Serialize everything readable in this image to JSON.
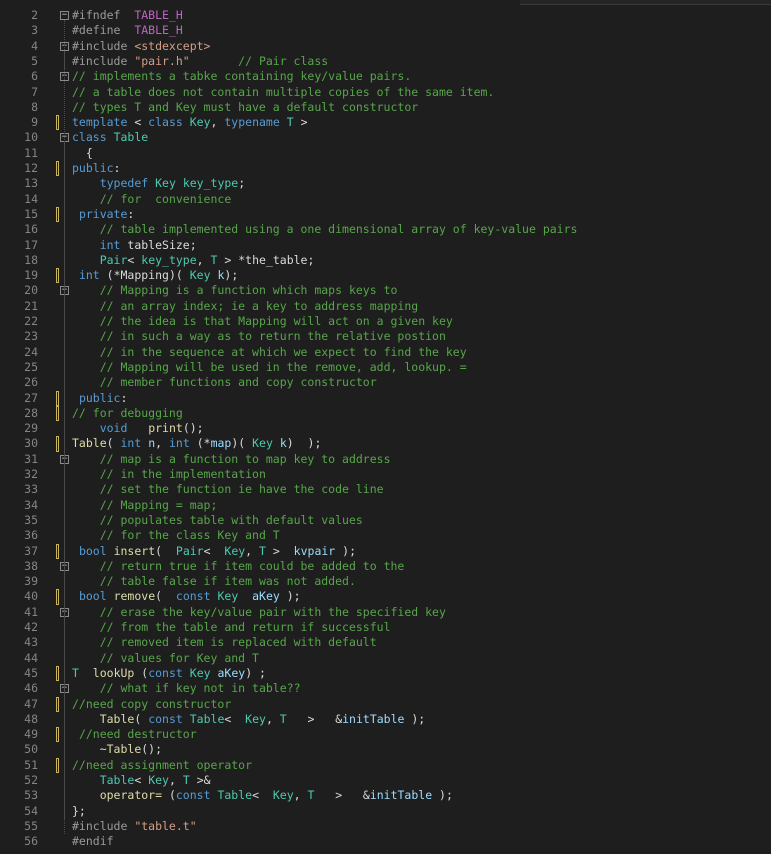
{
  "editor": {
    "language": "C++",
    "colors": {
      "background": "#1e1e1e",
      "line_number": "#858585",
      "keyword": "#569cd6",
      "type": "#4ec9b0",
      "string": "#d69d85",
      "comment": "#57a64a",
      "preprocessor": "#9b9b9b",
      "change_marker": "#c8b45a"
    },
    "lines": [
      {
        "n": "2",
        "fold": "minus",
        "change": false,
        "tokens": [
          [
            "pp",
            "#ifndef "
          ],
          [
            "mac",
            " TABLE_H"
          ]
        ]
      },
      {
        "n": "3",
        "fold": "",
        "change": false,
        "tokens": [
          [
            "pp",
            "#define "
          ],
          [
            "mac",
            " TABLE_H"
          ]
        ]
      },
      {
        "n": "4",
        "fold": "minus",
        "change": false,
        "tokens": [
          [
            "pp",
            "#include "
          ],
          [
            "str",
            "<stdexcept>"
          ]
        ]
      },
      {
        "n": "5",
        "fold": "",
        "change": false,
        "tokens": [
          [
            "pp",
            "#include "
          ],
          [
            "str",
            "\"pair.h\""
          ],
          [
            "id",
            "       "
          ],
          [
            "cm",
            "// Pair class"
          ]
        ]
      },
      {
        "n": "6",
        "fold": "minus",
        "change": false,
        "tokens": [
          [
            "cm",
            "// implements a tabke containing key/value pairs."
          ]
        ]
      },
      {
        "n": "7",
        "fold": "",
        "change": false,
        "tokens": [
          [
            "cm",
            "// a table does not contain multiple copies of the same item."
          ]
        ]
      },
      {
        "n": "8",
        "fold": "",
        "change": false,
        "tokens": [
          [
            "cm",
            "// types T and Key must have a default constructor"
          ]
        ]
      },
      {
        "n": "9",
        "fold": "",
        "change": true,
        "tokens": [
          [
            "kw",
            "template"
          ],
          [
            "id",
            " < "
          ],
          [
            "kw",
            "class"
          ],
          [
            "id",
            " "
          ],
          [
            "ty",
            "Key"
          ],
          [
            "id",
            ", "
          ],
          [
            "kw",
            "typename"
          ],
          [
            "id",
            " "
          ],
          [
            "ty",
            "T"
          ],
          [
            "id",
            " >"
          ]
        ]
      },
      {
        "n": "10",
        "fold": "minus",
        "change": false,
        "tokens": [
          [
            "kw",
            "class"
          ],
          [
            "id",
            " "
          ],
          [
            "ty",
            "Table"
          ]
        ]
      },
      {
        "n": "11",
        "fold": "",
        "change": false,
        "tokens": [
          [
            "id",
            "  {"
          ]
        ]
      },
      {
        "n": "12",
        "fold": "",
        "change": true,
        "tokens": [
          [
            "kw",
            "public"
          ],
          [
            "id",
            ":"
          ]
        ]
      },
      {
        "n": "13",
        "fold": "",
        "change": false,
        "tokens": [
          [
            "id",
            "    "
          ],
          [
            "kw",
            "typedef"
          ],
          [
            "id",
            " "
          ],
          [
            "ty",
            "Key"
          ],
          [
            "id",
            " "
          ],
          [
            "ty",
            "key_type"
          ],
          [
            "id",
            ";"
          ]
        ]
      },
      {
        "n": "14",
        "fold": "",
        "change": false,
        "tokens": [
          [
            "id",
            "    "
          ],
          [
            "cm",
            "// for  convenience"
          ]
        ]
      },
      {
        "n": "15",
        "fold": "",
        "change": true,
        "tokens": [
          [
            "id",
            " "
          ],
          [
            "kw",
            "private"
          ],
          [
            "id",
            ":"
          ]
        ]
      },
      {
        "n": "16",
        "fold": "",
        "change": false,
        "tokens": [
          [
            "id",
            "    "
          ],
          [
            "cm",
            "// table implemented using a one dimensional array of key-value pairs"
          ]
        ]
      },
      {
        "n": "17",
        "fold": "",
        "change": false,
        "tokens": [
          [
            "id",
            "    "
          ],
          [
            "kw",
            "int"
          ],
          [
            "id",
            " tableSize;"
          ]
        ]
      },
      {
        "n": "18",
        "fold": "",
        "change": false,
        "tokens": [
          [
            "id",
            "    "
          ],
          [
            "ty",
            "Pair"
          ],
          [
            "id",
            "< "
          ],
          [
            "ty",
            "key_type"
          ],
          [
            "id",
            ", "
          ],
          [
            "ty",
            "T"
          ],
          [
            "id",
            " > *the_table;"
          ]
        ]
      },
      {
        "n": "19",
        "fold": "",
        "change": true,
        "tokens": [
          [
            "id",
            " "
          ],
          [
            "kw",
            "int"
          ],
          [
            "id",
            " (*Mapping)( "
          ],
          [
            "ty",
            "Key"
          ],
          [
            "id",
            " "
          ],
          [
            "par",
            "k"
          ],
          [
            "id",
            ");"
          ]
        ]
      },
      {
        "n": "20",
        "fold": "minus",
        "change": false,
        "tokens": [
          [
            "id",
            "    "
          ],
          [
            "cm",
            "// Mapping is a function which maps keys to"
          ]
        ]
      },
      {
        "n": "21",
        "fold": "",
        "change": false,
        "tokens": [
          [
            "id",
            "    "
          ],
          [
            "cm",
            "// an array index; ie a key to address mapping"
          ]
        ]
      },
      {
        "n": "22",
        "fold": "",
        "change": false,
        "tokens": [
          [
            "id",
            "    "
          ],
          [
            "cm",
            "// the idea is that Mapping will act on a given key"
          ]
        ]
      },
      {
        "n": "23",
        "fold": "",
        "change": false,
        "tokens": [
          [
            "id",
            "    "
          ],
          [
            "cm",
            "// in such a way as to return the relative postion"
          ]
        ]
      },
      {
        "n": "24",
        "fold": "",
        "change": false,
        "tokens": [
          [
            "id",
            "    "
          ],
          [
            "cm",
            "// in the sequence at which we expect to find the key"
          ]
        ]
      },
      {
        "n": "25",
        "fold": "",
        "change": false,
        "tokens": [
          [
            "id",
            "    "
          ],
          [
            "cm",
            "// Mapping will be used in the remove, add, lookup. ="
          ]
        ]
      },
      {
        "n": "26",
        "fold": "",
        "change": false,
        "tokens": [
          [
            "id",
            "    "
          ],
          [
            "cm",
            "// member functions and copy constructor"
          ]
        ]
      },
      {
        "n": "27",
        "fold": "",
        "change": true,
        "tokens": [
          [
            "id",
            " "
          ],
          [
            "kw",
            "public"
          ],
          [
            "id",
            ":"
          ]
        ]
      },
      {
        "n": "28",
        "fold": "",
        "change": true,
        "tokens": [
          [
            "cm",
            "// for debugging"
          ]
        ]
      },
      {
        "n": "29",
        "fold": "",
        "change": false,
        "tokens": [
          [
            "id",
            "    "
          ],
          [
            "kw",
            "void"
          ],
          [
            "id",
            "   "
          ],
          [
            "fn",
            "print"
          ],
          [
            "id",
            "();"
          ]
        ]
      },
      {
        "n": "30",
        "fold": "",
        "change": true,
        "tokens": [
          [
            "fn",
            "Table"
          ],
          [
            "id",
            "( "
          ],
          [
            "kw",
            "int"
          ],
          [
            "id",
            " "
          ],
          [
            "par",
            "n"
          ],
          [
            "id",
            ", "
          ],
          [
            "kw",
            "int"
          ],
          [
            "id",
            " (*"
          ],
          [
            "par",
            "map"
          ],
          [
            "id",
            ")( "
          ],
          [
            "ty",
            "Key"
          ],
          [
            "id",
            " "
          ],
          [
            "par",
            "k"
          ],
          [
            "id",
            ")  );"
          ]
        ]
      },
      {
        "n": "31",
        "fold": "minus",
        "change": false,
        "tokens": [
          [
            "id",
            "    "
          ],
          [
            "cm",
            "// map is a function to map key to address"
          ]
        ]
      },
      {
        "n": "32",
        "fold": "",
        "change": false,
        "tokens": [
          [
            "id",
            "    "
          ],
          [
            "cm",
            "// in the implementation"
          ]
        ]
      },
      {
        "n": "33",
        "fold": "",
        "change": false,
        "tokens": [
          [
            "id",
            "    "
          ],
          [
            "cm",
            "// set the function ie have the code line"
          ]
        ]
      },
      {
        "n": "34",
        "fold": "",
        "change": false,
        "tokens": [
          [
            "id",
            "    "
          ],
          [
            "cm",
            "// Mapping = map;"
          ]
        ]
      },
      {
        "n": "35",
        "fold": "",
        "change": false,
        "tokens": [
          [
            "id",
            "    "
          ],
          [
            "cm",
            "// populates table with default values"
          ]
        ]
      },
      {
        "n": "36",
        "fold": "",
        "change": false,
        "tokens": [
          [
            "id",
            "    "
          ],
          [
            "cm",
            "// for the class Key and T"
          ]
        ]
      },
      {
        "n": "37",
        "fold": "",
        "change": true,
        "tokens": [
          [
            "id",
            " "
          ],
          [
            "kw",
            "bool"
          ],
          [
            "id",
            " "
          ],
          [
            "fn",
            "insert"
          ],
          [
            "id",
            "(  "
          ],
          [
            "ty",
            "Pair"
          ],
          [
            "id",
            "<  "
          ],
          [
            "ty",
            "Key"
          ],
          [
            "id",
            ", "
          ],
          [
            "ty",
            "T"
          ],
          [
            "id",
            " >  "
          ],
          [
            "par",
            "kvpair"
          ],
          [
            "id",
            " );"
          ]
        ]
      },
      {
        "n": "38",
        "fold": "minus",
        "change": false,
        "tokens": [
          [
            "id",
            "    "
          ],
          [
            "cm",
            "// return true if item could be added to the"
          ]
        ]
      },
      {
        "n": "39",
        "fold": "",
        "change": false,
        "tokens": [
          [
            "id",
            "    "
          ],
          [
            "cm",
            "// table false if item was not added."
          ]
        ]
      },
      {
        "n": "40",
        "fold": "",
        "change": true,
        "tokens": [
          [
            "id",
            " "
          ],
          [
            "kw",
            "bool"
          ],
          [
            "id",
            " "
          ],
          [
            "fn",
            "remove"
          ],
          [
            "id",
            "(  "
          ],
          [
            "kw",
            "const"
          ],
          [
            "id",
            " "
          ],
          [
            "ty",
            "Key"
          ],
          [
            "id",
            "  "
          ],
          [
            "par",
            "aKey"
          ],
          [
            "id",
            " );"
          ]
        ]
      },
      {
        "n": "41",
        "fold": "minus",
        "change": false,
        "tokens": [
          [
            "id",
            "    "
          ],
          [
            "cm",
            "// erase the key/value pair with the specified key"
          ]
        ]
      },
      {
        "n": "42",
        "fold": "",
        "change": false,
        "tokens": [
          [
            "id",
            "    "
          ],
          [
            "cm",
            "// from the table and return if successful"
          ]
        ]
      },
      {
        "n": "43",
        "fold": "",
        "change": false,
        "tokens": [
          [
            "id",
            "    "
          ],
          [
            "cm",
            "// removed item is replaced with default"
          ]
        ]
      },
      {
        "n": "44",
        "fold": "",
        "change": false,
        "tokens": [
          [
            "id",
            "    "
          ],
          [
            "cm",
            "// values for Key and T"
          ]
        ]
      },
      {
        "n": "45",
        "fold": "",
        "change": true,
        "tokens": [
          [
            "ty",
            "T"
          ],
          [
            "id",
            "  "
          ],
          [
            "fn",
            "lookUp"
          ],
          [
            "id",
            " ("
          ],
          [
            "kw",
            "const"
          ],
          [
            "id",
            " "
          ],
          [
            "ty",
            "Key"
          ],
          [
            "id",
            " "
          ],
          [
            "par",
            "aKey"
          ],
          [
            "id",
            ") ;"
          ]
        ]
      },
      {
        "n": "46",
        "fold": "minus",
        "change": false,
        "tokens": [
          [
            "id",
            "    "
          ],
          [
            "cm",
            "// what if key not in table??"
          ]
        ]
      },
      {
        "n": "47",
        "fold": "",
        "change": true,
        "tokens": [
          [
            "cm",
            "//need copy constructor"
          ]
        ]
      },
      {
        "n": "48",
        "fold": "",
        "change": false,
        "tokens": [
          [
            "id",
            "    "
          ],
          [
            "fn",
            "Table"
          ],
          [
            "id",
            "( "
          ],
          [
            "kw",
            "const"
          ],
          [
            "id",
            " "
          ],
          [
            "ty",
            "Table"
          ],
          [
            "id",
            "<  "
          ],
          [
            "ty",
            "Key"
          ],
          [
            "id",
            ", "
          ],
          [
            "ty",
            "T"
          ],
          [
            "id",
            "   >   &"
          ],
          [
            "par",
            "initTable"
          ],
          [
            "id",
            " );"
          ]
        ]
      },
      {
        "n": "49",
        "fold": "",
        "change": true,
        "tokens": [
          [
            "id",
            " "
          ],
          [
            "cm",
            "//need destructor"
          ]
        ]
      },
      {
        "n": "50",
        "fold": "",
        "change": false,
        "tokens": [
          [
            "id",
            "    ~"
          ],
          [
            "fn",
            "Table"
          ],
          [
            "id",
            "();"
          ]
        ]
      },
      {
        "n": "51",
        "fold": "",
        "change": true,
        "tokens": [
          [
            "cm",
            "//need assignment operator"
          ]
        ]
      },
      {
        "n": "52",
        "fold": "",
        "change": false,
        "tokens": [
          [
            "id",
            "    "
          ],
          [
            "ty",
            "Table"
          ],
          [
            "id",
            "< "
          ],
          [
            "ty",
            "Key"
          ],
          [
            "id",
            ", "
          ],
          [
            "ty",
            "T"
          ],
          [
            "id",
            " >&"
          ]
        ]
      },
      {
        "n": "53",
        "fold": "",
        "change": false,
        "tokens": [
          [
            "id",
            "    "
          ],
          [
            "fn",
            "operator="
          ],
          [
            "id",
            " ("
          ],
          [
            "kw",
            "const"
          ],
          [
            "id",
            " "
          ],
          [
            "ty",
            "Table"
          ],
          [
            "id",
            "<  "
          ],
          [
            "ty",
            "Key"
          ],
          [
            "id",
            ", "
          ],
          [
            "ty",
            "T"
          ],
          [
            "id",
            "   >   &"
          ],
          [
            "par",
            "initTable"
          ],
          [
            "id",
            " );"
          ]
        ]
      },
      {
        "n": "54",
        "fold": "",
        "change": false,
        "tokens": [
          [
            "id",
            "};"
          ]
        ]
      },
      {
        "n": "55",
        "fold": "",
        "change": false,
        "tokens": [
          [
            "pp",
            "#include "
          ],
          [
            "str",
            "\"table.t\""
          ]
        ]
      },
      {
        "n": "56",
        "fold": "",
        "change": false,
        "tokens": [
          [
            "pp",
            "#endif"
          ]
        ]
      }
    ]
  }
}
